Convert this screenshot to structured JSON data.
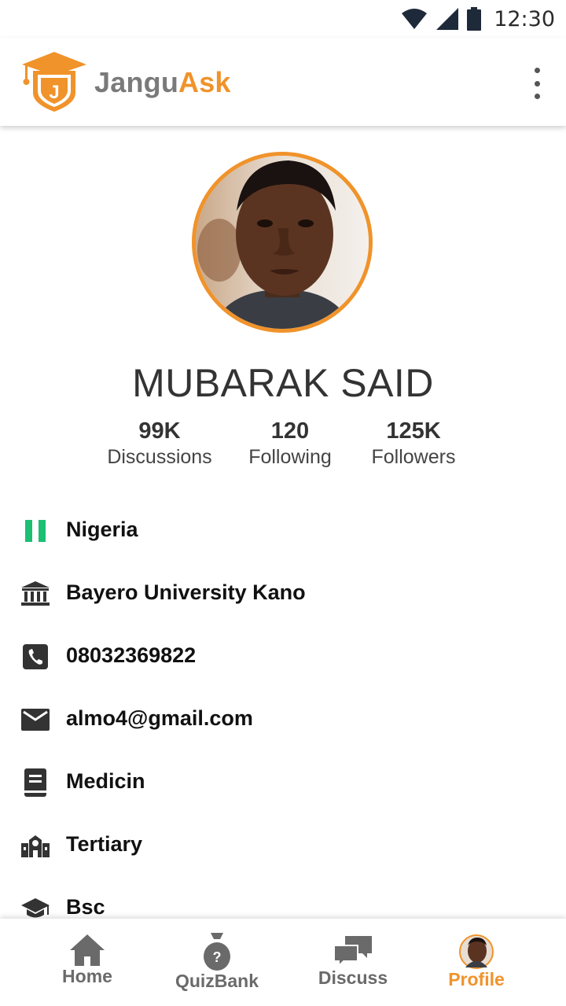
{
  "status_bar": {
    "time": "12:30"
  },
  "app": {
    "brand_part1": "Jangu",
    "brand_part2": "Ask",
    "logo_letter": "J"
  },
  "colors": {
    "accent": "#f0932b",
    "brand_gray": "#7a7a7a",
    "nigeria_green": "#1cbf73"
  },
  "profile": {
    "name": "MUBARAK SAID",
    "stats": [
      {
        "value": "99K",
        "label": "Discussions"
      },
      {
        "value": "120",
        "label": "Following"
      },
      {
        "value": "125K",
        "label": "Followers"
      }
    ],
    "info": [
      {
        "icon": "nigeria-flag-icon",
        "text": "Nigeria"
      },
      {
        "icon": "institution-icon",
        "text": "Bayero University Kano"
      },
      {
        "icon": "phone-icon",
        "text": "08032369822"
      },
      {
        "icon": "email-icon",
        "text": "almo4@gmail.com"
      },
      {
        "icon": "book-icon",
        "text": "Medicin"
      },
      {
        "icon": "school-icon",
        "text": "Tertiary"
      },
      {
        "icon": "graduation-cap-icon",
        "text": "Bsc"
      }
    ]
  },
  "bottom_nav": [
    {
      "icon": "home-icon",
      "label": "Home"
    },
    {
      "icon": "quiz-bag-icon",
      "label": "QuizBank"
    },
    {
      "icon": "discuss-icon",
      "label": "Discuss"
    },
    {
      "icon": "profile-avatar-icon",
      "label": "Profile",
      "active": true
    }
  ]
}
